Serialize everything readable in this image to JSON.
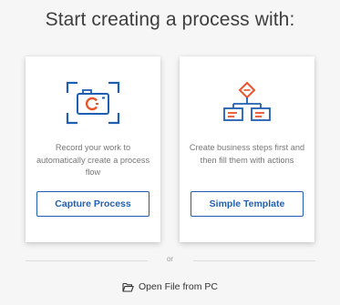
{
  "heading": "Start creating a process with:",
  "cards": [
    {
      "icon": "camera-capture-icon",
      "description": "Record your work to automatically create a process flow",
      "button_label": "Capture Process"
    },
    {
      "icon": "flowchart-template-icon",
      "description": "Create business steps first and then fill them with actions",
      "button_label": "Simple Template"
    }
  ],
  "divider_text": "or",
  "open_file": {
    "icon": "folder-open-icon",
    "label": "Open File from PC"
  },
  "colors": {
    "accent_blue": "#1f5fb2",
    "accent_orange": "#e8542a",
    "background": "#f6f6f6"
  }
}
